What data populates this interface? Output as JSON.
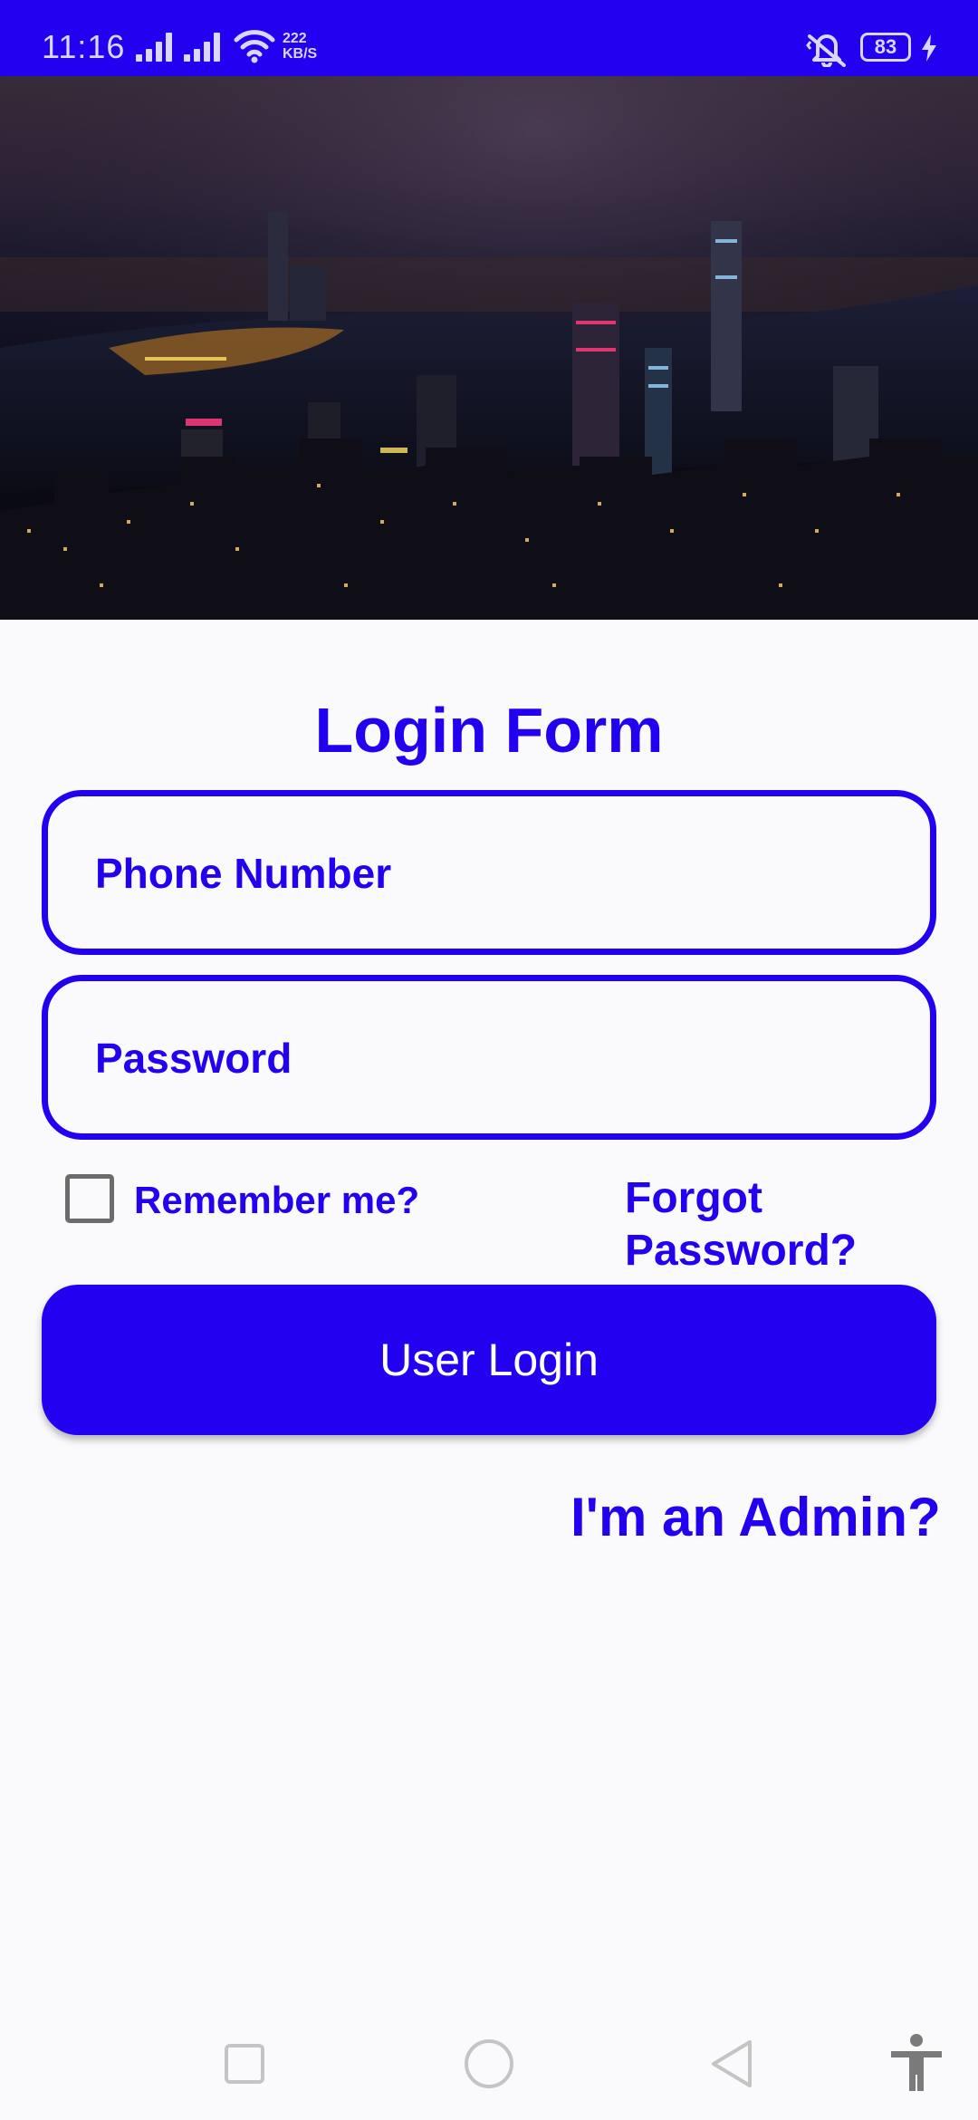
{
  "status_bar": {
    "time": "11:16",
    "net_speed_value": "222",
    "net_speed_unit": "KB/S",
    "battery_level": "83",
    "icons": [
      "signal-icon",
      "signal-icon",
      "wifi-icon",
      "vibrate-off-icon",
      "battery-icon",
      "charging-icon"
    ]
  },
  "hero": {
    "image": "night-city-skyline-image"
  },
  "login": {
    "title": "Login Form",
    "phone_placeholder": "Phone Number",
    "password_placeholder": "Password",
    "remember_label": "Remember me?",
    "remember_checked": false,
    "forgot_label": "Forgot Password?",
    "login_button_label": "User Login",
    "admin_label": "I'm an Admin?"
  },
  "nav_bar": {
    "icons": [
      "recents-icon",
      "home-icon",
      "back-icon",
      "accessibility-icon"
    ]
  },
  "colors": {
    "accent": "#2200f0",
    "background": "#faf9fb",
    "button_text": "#ffffff",
    "checkbox_border": "#6b6b6b",
    "nav_icons": "#c4c4c4"
  }
}
